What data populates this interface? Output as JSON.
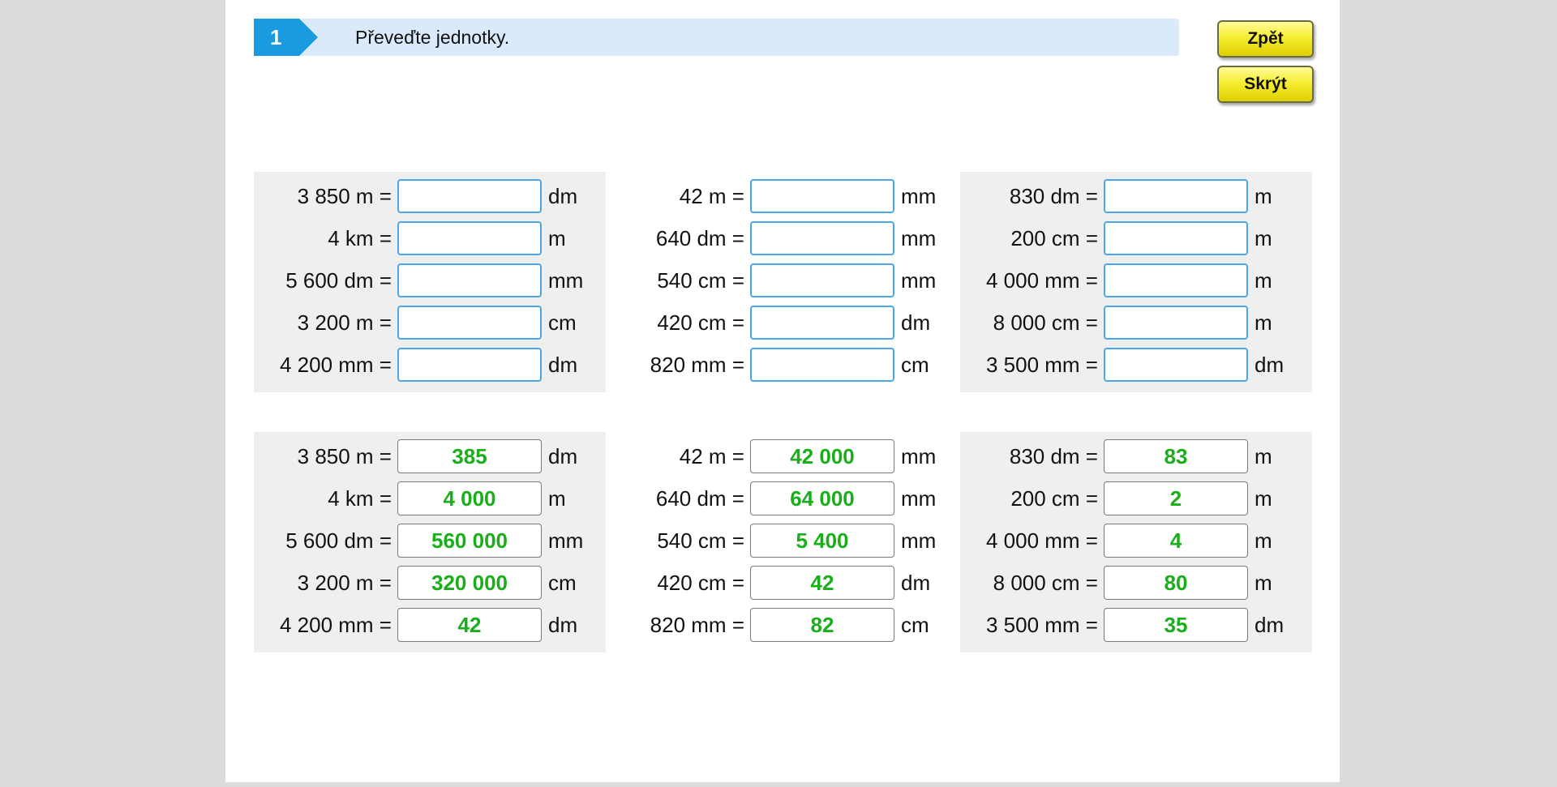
{
  "task": {
    "number": "1",
    "instruction": "Převeďte jednotky."
  },
  "buttons": {
    "back": "Zpět",
    "hide": "Skrýt"
  },
  "exercise": [
    [
      {
        "lhs": "3 850 m =",
        "unit": "dm",
        "answer": "385"
      },
      {
        "lhs": "4 km =",
        "unit": "m",
        "answer": "4 000"
      },
      {
        "lhs": "5 600 dm =",
        "unit": "mm",
        "answer": "560 000"
      },
      {
        "lhs": "3 200 m =",
        "unit": "cm",
        "answer": "320 000"
      },
      {
        "lhs": "4 200 mm =",
        "unit": "dm",
        "answer": "42"
      }
    ],
    [
      {
        "lhs": "42 m =",
        "unit": "mm",
        "answer": "42 000"
      },
      {
        "lhs": "640 dm =",
        "unit": "mm",
        "answer": "64 000"
      },
      {
        "lhs": "540 cm =",
        "unit": "mm",
        "answer": "5 400"
      },
      {
        "lhs": "420 cm =",
        "unit": "dm",
        "answer": "42"
      },
      {
        "lhs": "820 mm =",
        "unit": "cm",
        "answer": "82"
      }
    ],
    [
      {
        "lhs": "830 dm =",
        "unit": "m",
        "answer": "83"
      },
      {
        "lhs": "200 cm =",
        "unit": "m",
        "answer": "2"
      },
      {
        "lhs": "4 000 mm =",
        "unit": "m",
        "answer": "4"
      },
      {
        "lhs": "8 000 cm =",
        "unit": "m",
        "answer": "80"
      },
      {
        "lhs": "3 500 mm =",
        "unit": "dm",
        "answer": "35"
      }
    ]
  ],
  "colors": {
    "answer_text": "#1aae1a",
    "input_border": "#4aa8e8",
    "task_badge": "#1a9be0",
    "task_bar": "#dbeafa",
    "button_yellow": "#f7ee33"
  }
}
